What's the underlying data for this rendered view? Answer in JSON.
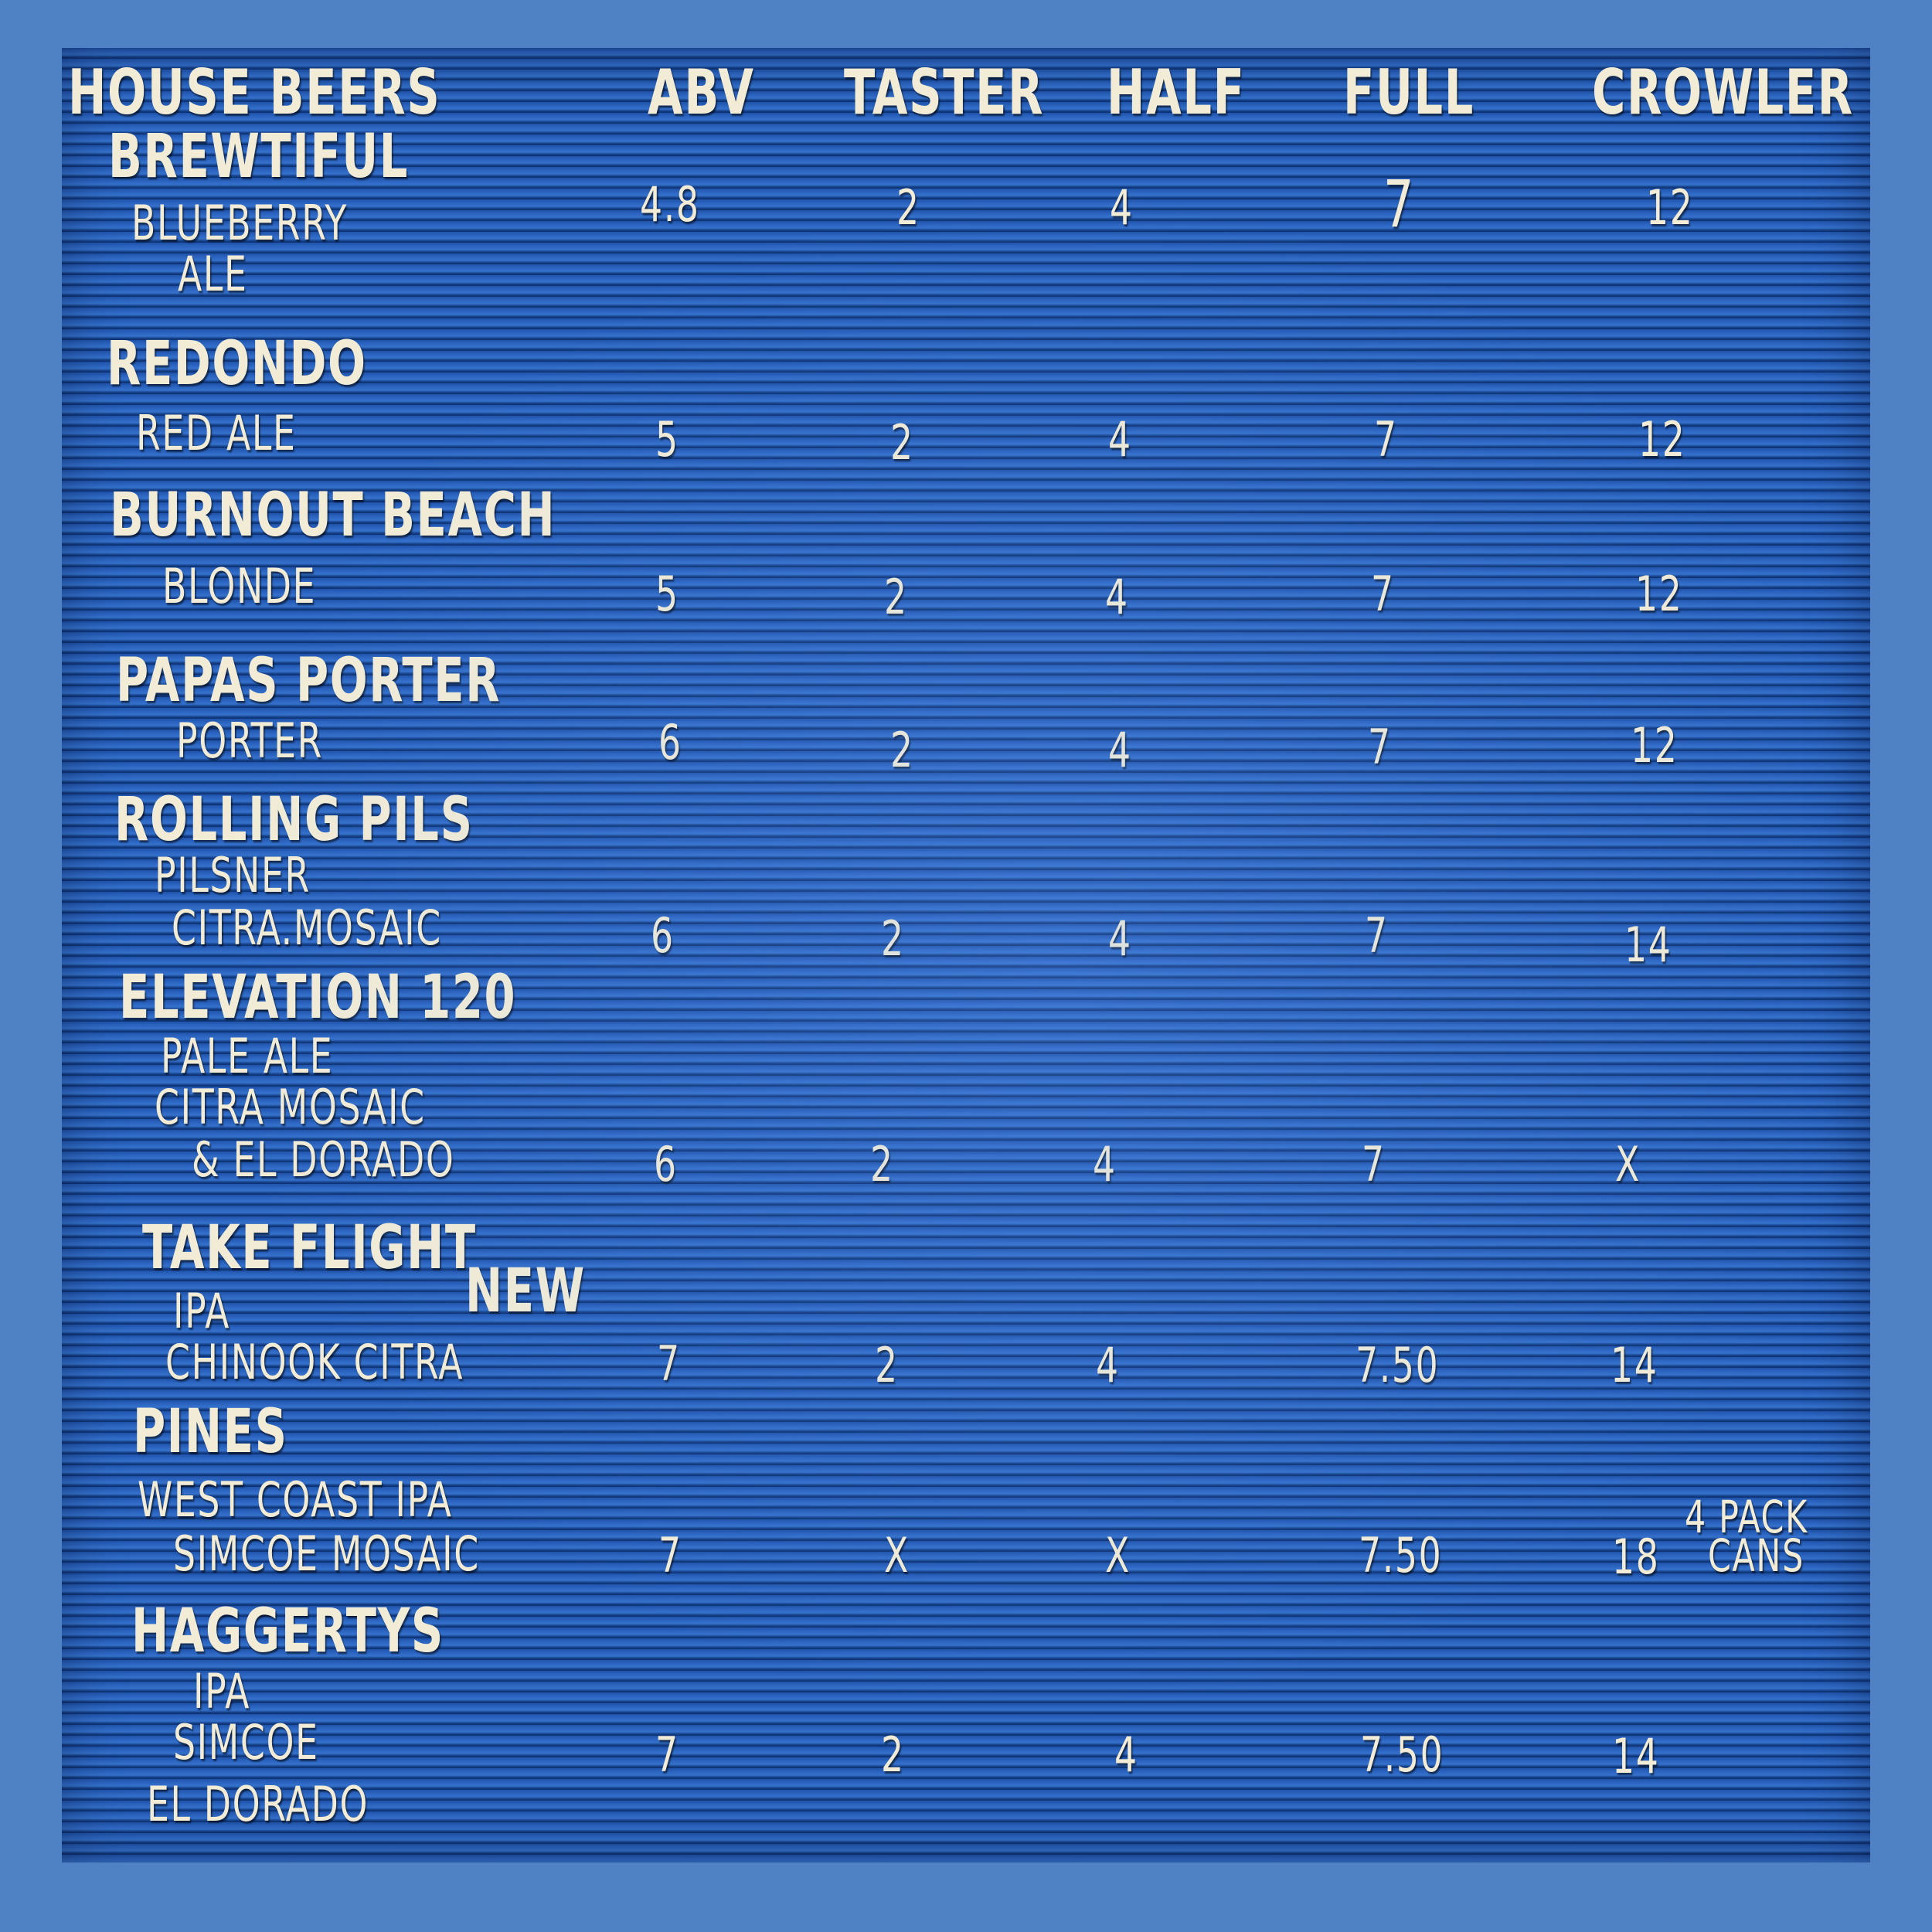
{
  "colors": {
    "frame": "#4f82c4",
    "board": "#1f52a8",
    "letters": "#f2ecd6"
  },
  "headers": {
    "house_beers": "HOUSE BEERS",
    "abv": "ABV",
    "taster": "TASTER",
    "half": "HALF",
    "full": "FULL",
    "crowler": "CROWLER"
  },
  "beers": [
    {
      "name": "BREWTIFUL",
      "lines": [
        "BLUEBERRY",
        "ALE"
      ],
      "abv": "4.8",
      "taster": "2",
      "half": "4",
      "full": "7",
      "crowler": "12"
    },
    {
      "name": "REDONDO",
      "lines": [
        "RED ALE"
      ],
      "abv": "5",
      "taster": "2",
      "half": "4",
      "full": "7",
      "crowler": "12"
    },
    {
      "name": "BURNOUT BEACH",
      "lines": [
        "BLONDE"
      ],
      "abv": "5",
      "taster": "2",
      "half": "4",
      "full": "7",
      "crowler": "12"
    },
    {
      "name": "PAPAS PORTER",
      "lines": [
        "PORTER"
      ],
      "abv": "6",
      "taster": "2",
      "half": "4",
      "full": "7",
      "crowler": "12"
    },
    {
      "name": "ROLLING PILS",
      "lines": [
        "PILSNER",
        "CITRA.MOSAIC"
      ],
      "abv": "6",
      "taster": "2",
      "half": "4",
      "full": "7",
      "crowler": "14"
    },
    {
      "name": "ELEVATION 120",
      "lines": [
        "PALE ALE",
        "CITRA MOSAIC",
        "& EL DORADO"
      ],
      "abv": "6",
      "taster": "2",
      "half": "4",
      "full": "7",
      "crowler": "X"
    },
    {
      "name": "TAKE FLIGHT",
      "lines": [
        "IPA",
        "CHINOOK CITRA"
      ],
      "abv": "7",
      "taster": "2",
      "half": "4",
      "full": "7.50",
      "crowler": "14"
    },
    {
      "name": "PINES",
      "lines": [
        "WEST COAST IPA",
        "SIMCOE MOSAIC"
      ],
      "abv": "7",
      "taster": "X",
      "half": "X",
      "full": "7.50",
      "crowler": "18"
    },
    {
      "name": "HAGGERTYS",
      "lines": [
        "IPA",
        "SIMCOE",
        "EL DORADO"
      ],
      "abv": "7",
      "taster": "2",
      "half": "4",
      "full": "7.50",
      "crowler": "14"
    }
  ],
  "notes": {
    "new": "NEW",
    "four_pack_1": "4 PACK",
    "four_pack_2": "CANS"
  }
}
